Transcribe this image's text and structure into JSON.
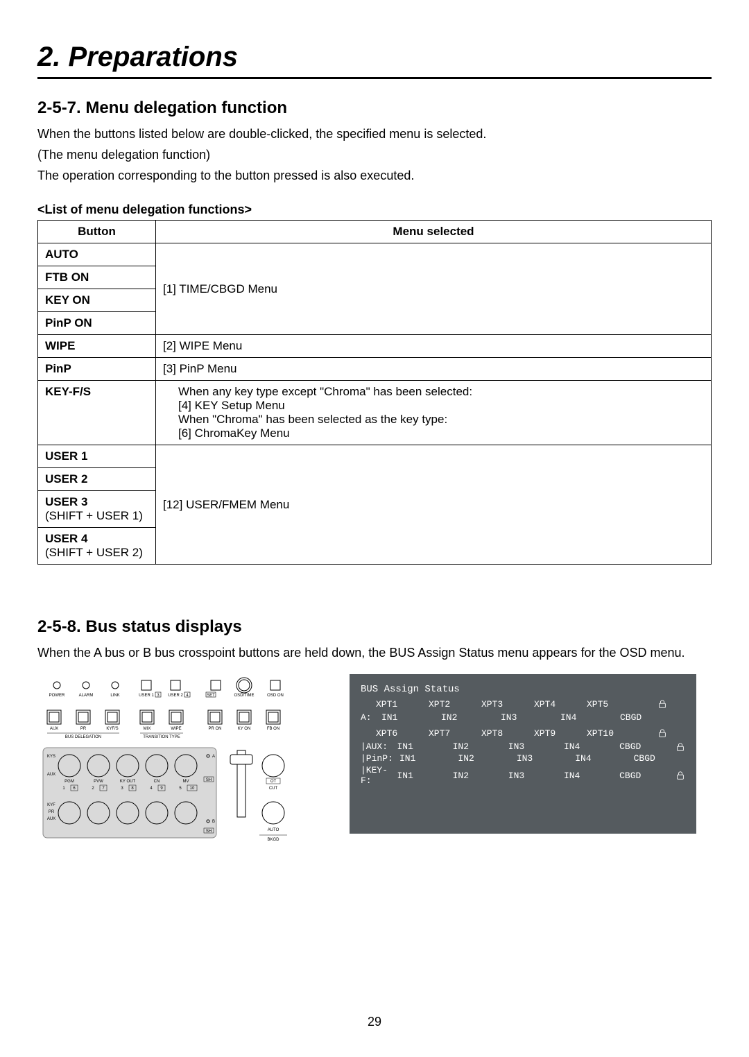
{
  "chapter_title": "2. Preparations",
  "section1": {
    "heading": "2-5-7. Menu delegation function",
    "para1": "When the buttons listed below are double-clicked, the specified menu is selected.",
    "para2": "(The menu delegation function)",
    "para3": "The operation corresponding to the button pressed is also executed.",
    "table_caption": "<List of menu delegation functions>",
    "table": {
      "header": {
        "col1": "Button",
        "col2": "Menu selected"
      },
      "rows": [
        {
          "button": "AUTO",
          "sub": "",
          "menu": "[1] TIME/CBGD Menu",
          "rowspan": 4,
          "first": true
        },
        {
          "button": "FTB ON",
          "sub": ""
        },
        {
          "button": "KEY ON",
          "sub": ""
        },
        {
          "button": "PinP ON",
          "sub": ""
        },
        {
          "button": "WIPE",
          "sub": "",
          "menu": "[2] WIPE Menu",
          "rowspan": 1,
          "first": true
        },
        {
          "button": "PinP",
          "sub": "",
          "menu": "[3] PinP Menu",
          "rowspan": 1,
          "first": true
        },
        {
          "button": "KEY-F/S",
          "sub": "",
          "menu_lines": [
            "When any key type except \"Chroma\" has been selected:",
            "[4] KEY Setup Menu",
            "When \"Chroma\" has been selected as the key type:",
            "[6] ChromaKey Menu"
          ],
          "rowspan": 1,
          "first": true
        },
        {
          "button": "USER 1",
          "sub": "",
          "menu": "[12] USER/FMEM Menu",
          "rowspan": 4,
          "first": true
        },
        {
          "button": "USER 2",
          "sub": ""
        },
        {
          "button": "USER 3",
          "sub": "(SHIFT + USER 1)"
        },
        {
          "button": "USER 4",
          "sub": "(SHIFT + USER 2)"
        }
      ]
    }
  },
  "section2": {
    "heading": "2-5-8. Bus status displays",
    "para1": "When the A bus or B bus crosspoint buttons are held down, the BUS Assign Status menu appears for the OSD menu.",
    "panel_labels": {
      "top_row": [
        "POWER",
        "ALARM",
        "LINK",
        "USER 1",
        "USER 2",
        "SET",
        "OSD/TIME",
        "OSD ON"
      ],
      "user_boxes": [
        "3",
        "4"
      ],
      "mid_row": [
        "AUX",
        "PR",
        "KYF/S",
        "MIX",
        "WIPE",
        "PR ON",
        "KY ON",
        "FB ON"
      ],
      "bus_delegation_label": "BUS DELEGATION",
      "transition_type_label": "TRANSITION TYPE",
      "grid_top_labels": [
        "KYS",
        "AUX"
      ],
      "grid_pgm_row": [
        "PGM",
        "PVW",
        "KY OUT",
        "CN",
        "MV"
      ],
      "grid_nums_top": [
        "1",
        "2",
        "3",
        "4",
        "5"
      ],
      "grid_shift_nums": [
        "6",
        "7",
        "8",
        "9",
        "10"
      ],
      "grid_bottom_labels": [
        "KYF",
        "PR",
        "AUX"
      ],
      "side_labels": [
        "A",
        "SH",
        "B",
        "SH",
        "OT"
      ],
      "cut_label": "CUT",
      "auto_label": "AUTO",
      "bkgd_label": "BKGD"
    },
    "osd": {
      "title": "BUS Assign Status",
      "col_heads": [
        "XPT1",
        "XPT2",
        "XPT3",
        "XPT4",
        "XPT5"
      ],
      "col_heads2": [
        "XPT6",
        "XPT7",
        "XPT8",
        "XPT9",
        "XPT10"
      ],
      "rowA": {
        "label": "A:",
        "cells": [
          "IN1",
          "IN2",
          "IN3",
          "IN4",
          "CBGD"
        ]
      },
      "rowAUX": {
        "label": "|AUX:",
        "cells": [
          "IN1",
          "IN2",
          "IN3",
          "IN4",
          "CBGD"
        ]
      },
      "rowPinP": {
        "label": "|PinP:",
        "cells": [
          "IN1",
          "IN2",
          "IN3",
          "IN4",
          "CBGD"
        ]
      },
      "rowKeyF": {
        "label": "|KEY-F:",
        "cells": [
          "IN1",
          "IN2",
          "IN3",
          "IN4",
          "CBGD"
        ]
      }
    }
  },
  "page_number": "29"
}
